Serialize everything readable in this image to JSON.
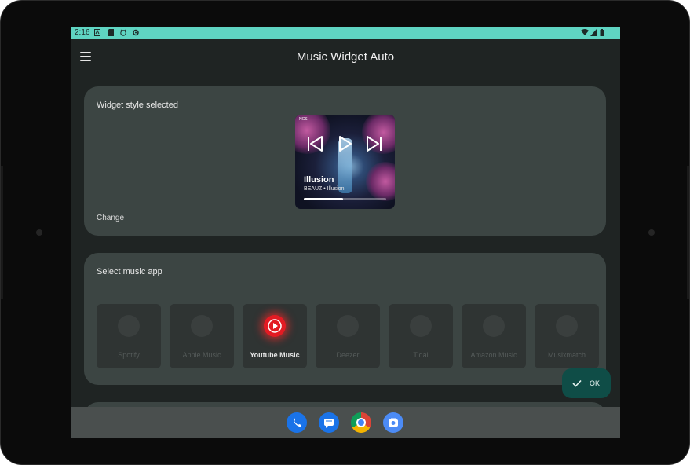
{
  "status_bar": {
    "time": "2:16"
  },
  "app_bar": {
    "title": "Music Widget Auto"
  },
  "widget_card": {
    "title": "Widget style selected",
    "change_label": "Change",
    "widget": {
      "brand": "NCS",
      "song": "Illusion",
      "artist": "BEAUZ • Illusion",
      "progress": 0.48
    }
  },
  "music_app_card": {
    "title": "Select music app",
    "apps": [
      {
        "label": "Spotify",
        "selected": false
      },
      {
        "label": "Apple Music",
        "selected": false
      },
      {
        "label": "Youtube Music",
        "selected": true
      },
      {
        "label": "Deezer",
        "selected": false
      },
      {
        "label": "Tidal",
        "selected": false
      },
      {
        "label": "Amazon Music",
        "selected": false
      },
      {
        "label": "Musixmatch",
        "selected": false
      }
    ]
  },
  "fab": {
    "label": "OK"
  },
  "dock": [
    "phone-icon",
    "messages-icon",
    "chrome-icon",
    "camera-icon"
  ],
  "colors": {
    "status_bar": "#5fd4c2",
    "card": "#3c4543",
    "fab": "#0f4d47",
    "selected_app": "#e31b23"
  }
}
